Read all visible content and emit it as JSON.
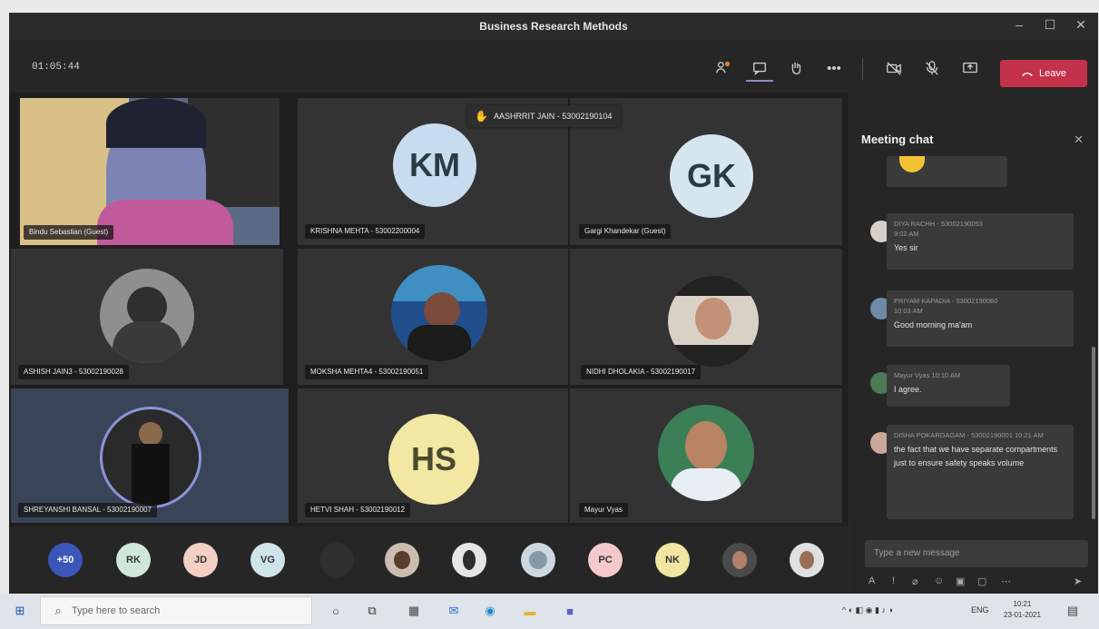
{
  "window": {
    "title": "Business Research Methods",
    "minimize": "–",
    "maximize": "☐",
    "close": "✕"
  },
  "toolbar": {
    "timer": "01:05:44",
    "leave_label": "Leave"
  },
  "raised_hand": {
    "label": "AASHRRIT JAIN - 53002190104"
  },
  "tiles": [
    {
      "id": "host",
      "name": "Bindu Sebastian (Guest)"
    },
    {
      "id": "km",
      "initials": "KM",
      "name": "KRISHNA MEHTA - 53002200004"
    },
    {
      "id": "gk",
      "initials": "GK",
      "name": "Gargi Khandekar (Guest)"
    },
    {
      "id": "ashish",
      "name": "ASHISH JAIN3 - 53002190028"
    },
    {
      "id": "moksha",
      "name": "MOKSHA MEHTA4 - 53002190051"
    },
    {
      "id": "nidhi",
      "name": "NIDHI DHOLAKIA - 53002190017"
    },
    {
      "id": "shreyanshi",
      "name": "SHREYANSHI BANSAL - 53002190007"
    },
    {
      "id": "hs",
      "initials": "HS",
      "name": "HETVI SHAH - 53002190012"
    },
    {
      "id": "mayur",
      "name": "Mayur Vyas"
    }
  ],
  "chat": {
    "title": "Meeting chat",
    "close_label": "✕",
    "messages": [
      {
        "author": "DIYA RACHH - 53002190053",
        "time": "9:02 AM",
        "text": "Yes sir"
      },
      {
        "author": "PRIYAM KAPADIA - 53002190060",
        "time": "10:03 AM",
        "text": "Good morning ma'am"
      },
      {
        "author": "Mayur Vyas",
        "time": "10:10 AM",
        "text": "I agree."
      },
      {
        "author": "DISHA POKARDAGAM - 53002190001",
        "time": "10:21 AM",
        "text": "the fact that we have separate compartments just to ensure safety speaks volume"
      }
    ],
    "compose_placeholder": "Type a new message"
  },
  "strip": {
    "overflow": "+50",
    "avatars": [
      "RK",
      "JD",
      "VG",
      "",
      "",
      "",
      "",
      "PC",
      "NK",
      "",
      ""
    ]
  },
  "taskbar": {
    "search_placeholder": "Type here to search",
    "language": "ENG",
    "time": "10:21",
    "date": "23-01-2021"
  },
  "colors": {
    "leave": "#c4314b",
    "avatar_blue": "#c8dcef",
    "avatar_yellow": "#f2e7a3",
    "panel": "#262626",
    "stage": "#1f1f1f"
  }
}
